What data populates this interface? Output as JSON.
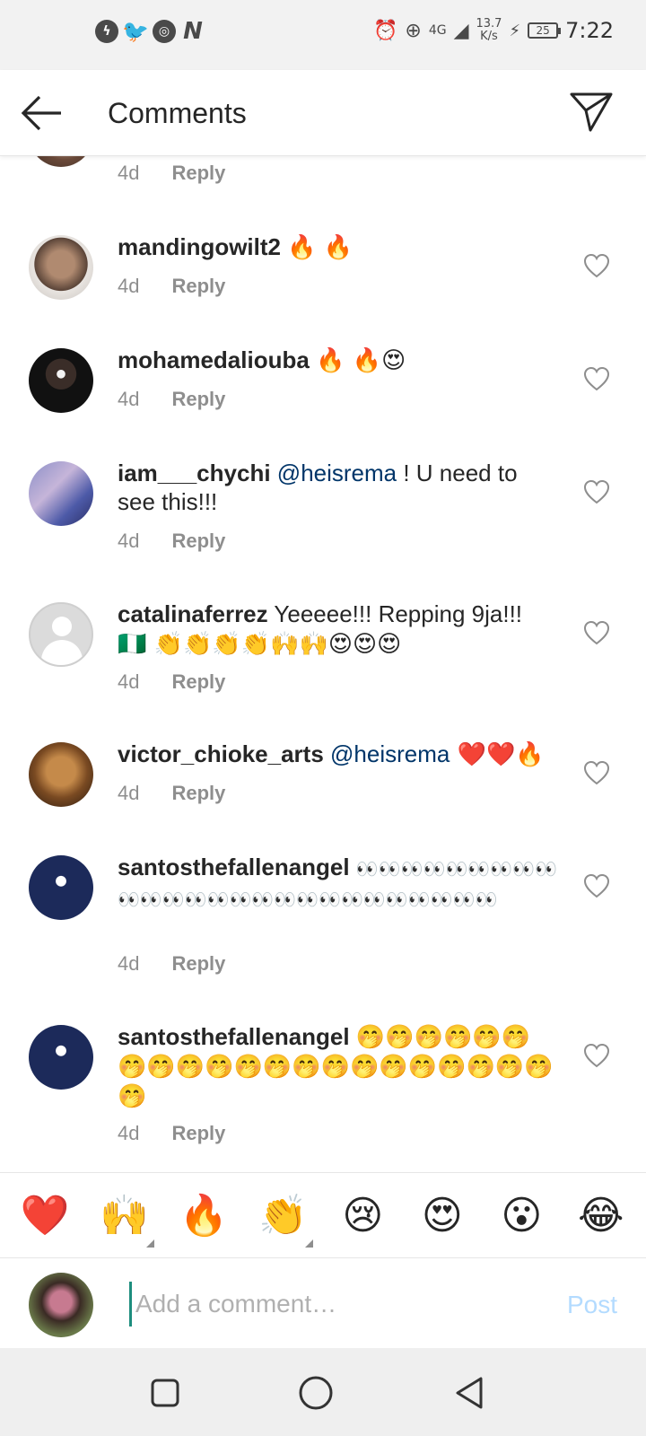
{
  "status_bar": {
    "app_icons": [
      "messenger-icon",
      "twitter-icon",
      "chrome-icon",
      "n-icon"
    ],
    "network": "4G",
    "speed_value": "13.7",
    "speed_unit": "K/s",
    "battery": "25",
    "time": "7:22"
  },
  "header": {
    "title": "Comments"
  },
  "comments": [
    {
      "user": "",
      "segments": [],
      "time": "4d",
      "reply": "Reply"
    },
    {
      "user": "mandingowilt2",
      "segments": [
        {
          "t": "🔥 🔥",
          "type": "emoji"
        }
      ],
      "time": "4d",
      "reply": "Reply"
    },
    {
      "user": "mohamedaliouba",
      "segments": [
        {
          "t": "🔥 🔥😍",
          "type": "emoji"
        }
      ],
      "time": "4d",
      "reply": "Reply"
    },
    {
      "user": "iam___chychi",
      "segments": [
        {
          "t": "@heisrema",
          "type": "mention"
        },
        {
          "t": " ! U need to see this!!!",
          "type": "text"
        }
      ],
      "time": "4d",
      "reply": "Reply"
    },
    {
      "user": "catalinaferrez",
      "segments": [
        {
          "t": "Yeeeee!!! Repping 9ja!!!",
          "type": "text"
        },
        {
          "t": " 🇳🇬 👏👏👏👏🙌🙌😍😍😍",
          "type": "emoji"
        }
      ],
      "time": "4d",
      "reply": "Reply"
    },
    {
      "user": "victor_chioke_arts",
      "segments": [
        {
          "t": "@heisrema",
          "type": "mention"
        },
        {
          "t": " ❤️❤️🔥",
          "type": "emoji"
        }
      ],
      "time": "4d",
      "reply": "Reply"
    },
    {
      "user": "santosthefallenangel",
      "segments": [
        {
          "t": "👀👀👀👀👀👀👀👀👀👀👀👀👀👀👀👀👀👀👀👀👀👀👀👀👀👀",
          "type": "emoji"
        }
      ],
      "time": "4d",
      "reply": "Reply"
    },
    {
      "user": "santosthefallenangel",
      "segments": [
        {
          "t": "🤭🤭🤭🤭🤭🤭🤭🤭🤭🤭🤭🤭🤭🤭🤭🤭🤭🤭🤭🤭🤭🤭",
          "type": "emoji"
        }
      ],
      "time": "4d",
      "reply": "Reply"
    }
  ],
  "quick_emojis": [
    "❤️",
    "🙌",
    "🔥",
    "👏",
    "😢",
    "😍",
    "😮",
    "😂"
  ],
  "composer": {
    "placeholder": "Add a comment…",
    "post_label": "Post"
  },
  "colors": {
    "mention": "#003569",
    "meta": "#8e8e8e",
    "post_disabled": "#b3dbff"
  }
}
